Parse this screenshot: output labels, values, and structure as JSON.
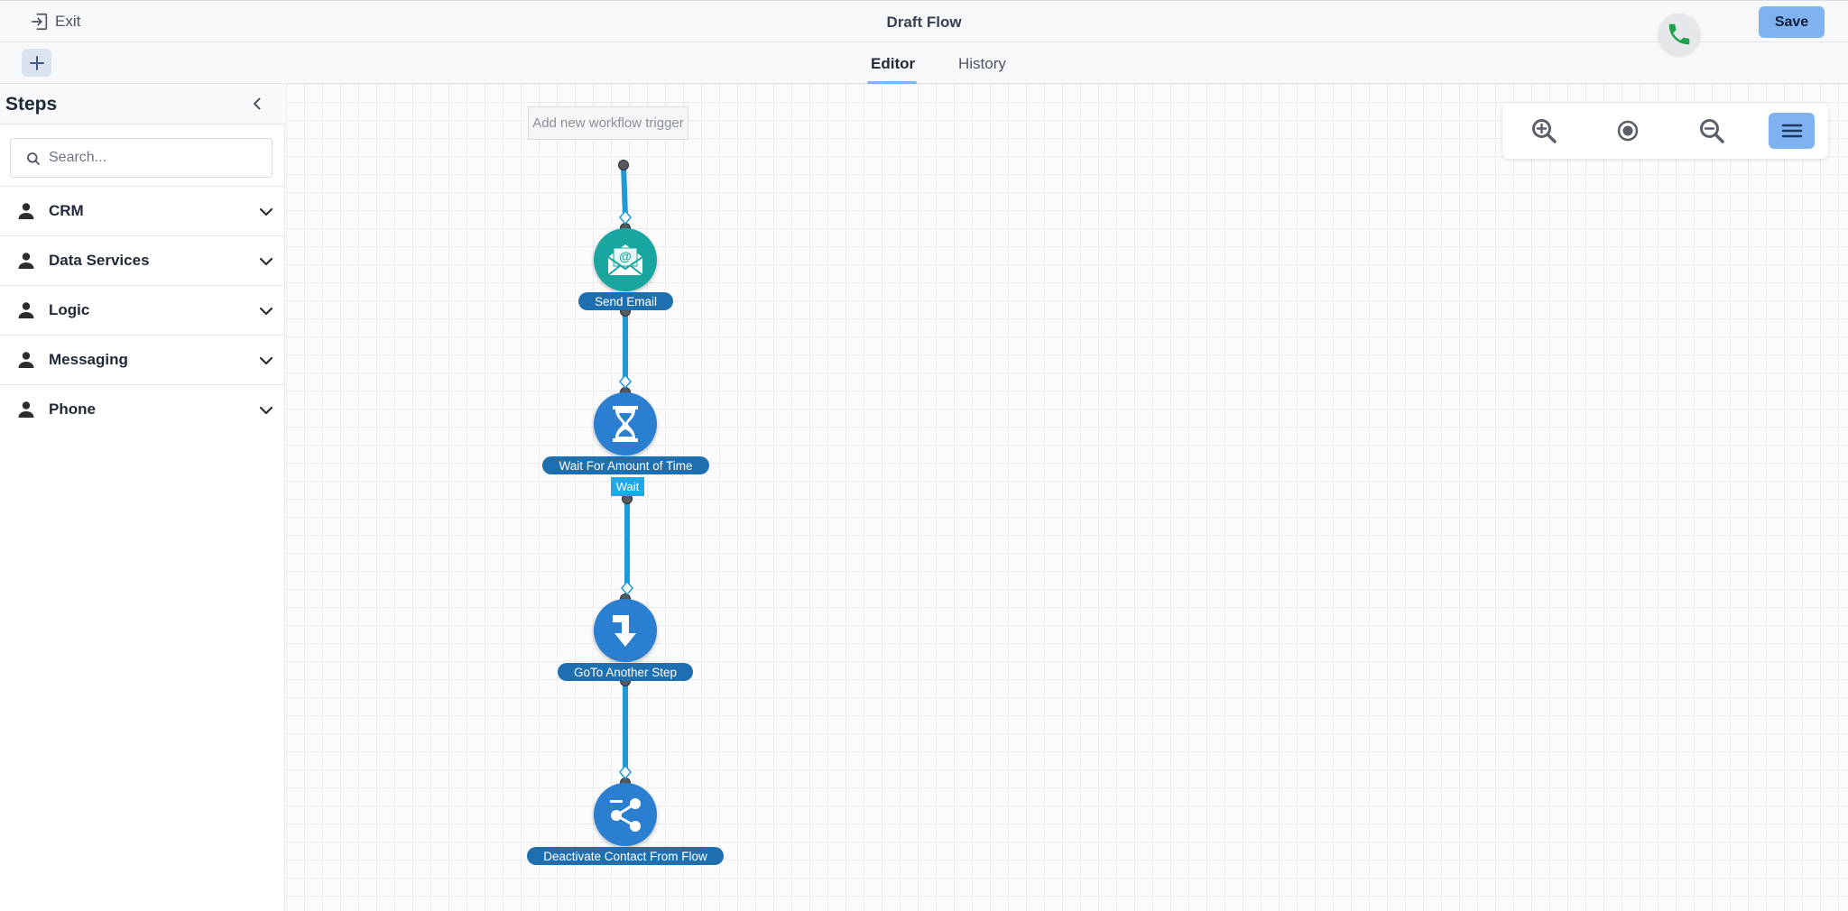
{
  "header": {
    "exit_label": "Exit",
    "title": "Draft Flow",
    "save_label": "Save",
    "save_color": "#7fb3ef",
    "phone_icon": "phone-icon",
    "phone_color": "#1aa34a"
  },
  "tabs": [
    {
      "label": "Editor",
      "active": true
    },
    {
      "label": "History",
      "active": false
    }
  ],
  "sidebar": {
    "title": "Steps",
    "search_placeholder": "Search...",
    "categories": [
      {
        "label": "CRM",
        "icon": "person-icon"
      },
      {
        "label": "Data Services",
        "icon": "person-icon"
      },
      {
        "label": "Logic",
        "icon": "person-icon"
      },
      {
        "label": "Messaging",
        "icon": "person-icon"
      },
      {
        "label": "Phone",
        "icon": "person-icon"
      }
    ]
  },
  "canvas": {
    "trigger_placeholder": "Add new workflow trigger",
    "connector_color": "#1d9bd6",
    "nodes": [
      {
        "label": "Send Email",
        "icon": "email-icon",
        "color": "#1aa6a0"
      },
      {
        "label": "Wait For Amount of Time",
        "icon": "hourglass-icon",
        "color": "#2b7fd0"
      },
      {
        "label": "GoTo Another Step",
        "icon": "goto-arrow-icon",
        "color": "#2b7fd0"
      },
      {
        "label": "Deactivate Contact From Flow",
        "icon": "share-icon",
        "color": "#2b7fd0"
      }
    ],
    "wait_tag": "Wait"
  },
  "zoom_controls": {
    "items": [
      "zoom-in-icon",
      "center-icon",
      "zoom-out-icon",
      "menu-icon"
    ]
  }
}
